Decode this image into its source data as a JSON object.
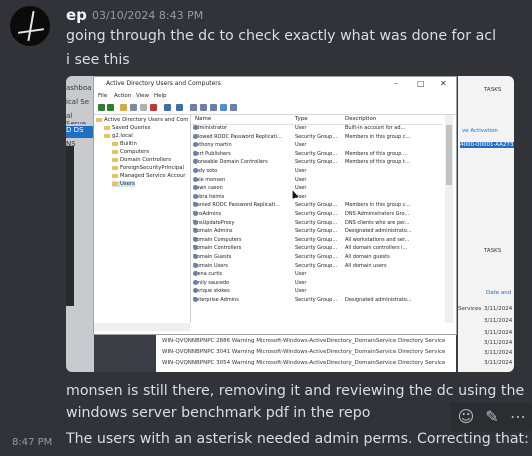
{
  "author": "ep",
  "timestamp": "03/10/2024 8:43 PM",
  "messages": [
    "going through the dc to check exactly  what was done for acl",
    "i see this",
    "monsen is still there, removing it and reviewing the dc using the",
    "windows server benchmark pdf in the repo",
    "The users with an asterisk needed admin perms. Correcting that:"
  ],
  "side_timestamp": "8:47 PM",
  "screenshot": {
    "window_title": "Active Directory Users and Computers",
    "menu": [
      "File",
      "Action",
      "View",
      "Help"
    ],
    "tree": [
      "Active Directory Users and Com",
      "Saved Queries",
      "g2.local",
      "Builtin",
      "Computers",
      "Domain Controllers",
      "ForeignSecurityPrincipal",
      "Managed Service Accour",
      "Users"
    ],
    "columns": [
      "Name",
      "Type",
      "Description"
    ],
    "rows": [
      {
        "name": "Administrator",
        "type": "User",
        "desc": "Built-in account for ad..."
      },
      {
        "name": "Allowed RODC Password Replicati...",
        "type": "Security Group...",
        "desc": "Members in this group c..."
      },
      {
        "name": "anthony martin",
        "type": "User",
        "desc": ""
      },
      {
        "name": "Cert Publishers",
        "type": "Security Group...",
        "desc": "Members of this group ..."
      },
      {
        "name": "Cloneable Domain Controllers",
        "type": "Security Group...",
        "desc": "Members of this group t..."
      },
      {
        "name": "cody soto",
        "type": "User",
        "desc": ""
      },
      {
        "name": "dale monsen",
        "type": "User",
        "desc": ""
      },
      {
        "name": "dawn cason",
        "type": "User",
        "desc": ""
      },
      {
        "name": "debra helms",
        "type": "User",
        "desc": ""
      },
      {
        "name": "Denied RODC Password Replicati...",
        "type": "Security Group...",
        "desc": "Members in this group c..."
      },
      {
        "name": "DnsAdmins",
        "type": "Security Group...",
        "desc": "DNS Administrators Gro..."
      },
      {
        "name": "DnsUpdateProxy",
        "type": "Security Group...",
        "desc": "DNS clients who are per..."
      },
      {
        "name": "Domain Admins",
        "type": "Security Group...",
        "desc": "Designated administrato..."
      },
      {
        "name": "Domain Computers",
        "type": "Security Group...",
        "desc": "All workstations and ser..."
      },
      {
        "name": "Domain Controllers",
        "type": "Security Group...",
        "desc": "All domain controllers i..."
      },
      {
        "name": "Domain Guests",
        "type": "Security Group...",
        "desc": "All domain guests"
      },
      {
        "name": "Domain Users",
        "type": "Security Group...",
        "desc": "All domain users"
      },
      {
        "name": "elena curtic",
        "type": "User",
        "desc": ""
      },
      {
        "name": "emily saucedo",
        "type": "User",
        "desc": ""
      },
      {
        "name": "enrique stokes",
        "type": "User",
        "desc": ""
      },
      {
        "name": "Enterprise Admins",
        "type": "Security Group...",
        "desc": "Designated administrato..."
      }
    ],
    "bg_left": [
      "ashboa",
      "ical Se",
      "al Serve",
      "D DS",
      "NS",
      "ile"
    ],
    "bg_right": [
      "TASKS",
      "ve Activation",
      "4000-00001-AA273",
      "TASKS",
      "Date and",
      "Services",
      "3/11/2024",
      "3/11/2024",
      "3/11/2024",
      "3/11/2024",
      "3/11/2024",
      "3/11/2024",
      "3/11/2024"
    ],
    "bg_bottom": [
      "WIN-QVQNNBPNPC  2886  Warning  Microsoft-Windows-ActiveDirectory_DomainService  Directory Service",
      "WIN-QVQNNBPNPC  3041  Warning  Microsoft-Windows-ActiveDirectory_DomainService  Directory Service",
      "WIN-QVQNNBPNPC  3054  Warning  Microsoft-Windows-ActiveDirectory_DomainService  Directory Service"
    ]
  }
}
